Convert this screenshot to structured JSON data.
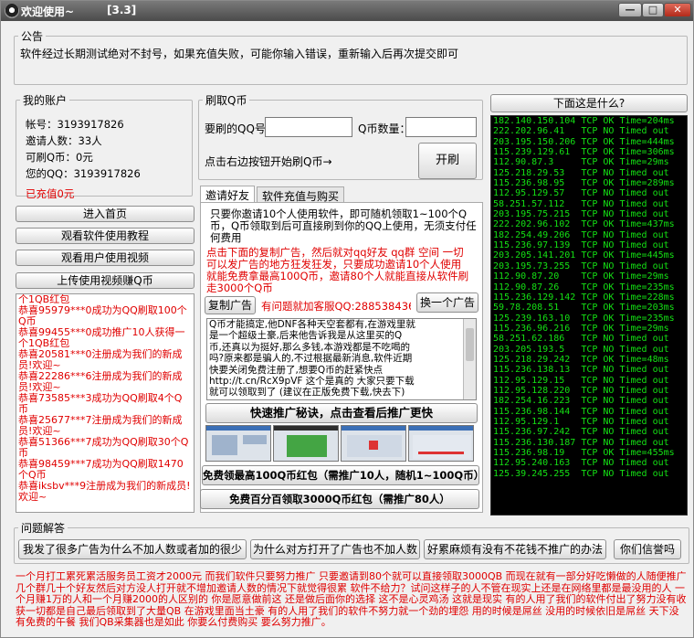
{
  "window": {
    "title": "欢迎使用~",
    "version": "[3.3]",
    "min_icon": "minimize-icon",
    "max_icon": "maximize-icon",
    "close_icon": "close-icon",
    "min_glyph": "—",
    "max_glyph": "□",
    "close_glyph": "✕"
  },
  "notice": {
    "legend": "公告",
    "text": "软件经过长期测试绝对不封号，如果充值失败，可能你输入错误，重新输入后再次提交即可"
  },
  "account": {
    "legend": "我的账户",
    "account_line": "帐号：3193917826",
    "invite_line": "邀请人数：33人",
    "can_claim_line": "可刷Q币：0元",
    "qq_line": "您的QQ：3193917826",
    "recharged_line": "已充值0元"
  },
  "left_buttons": {
    "enter_home": "进入首页",
    "watch_tutorial": "观看软件使用教程",
    "watch_user_video": "观看用户使用视频",
    "upload_video": "上传使用视频赚Q币"
  },
  "feed": [
    "个1QB红包",
    "恭喜95979***0成功为QQ刷取100个Q币",
    "恭喜99455***0成功推广10人获得一个1QB红包",
    "恭喜20581***0注册成为我们的新成员!欢迎~",
    "恭喜22286***6注册成为我们的新成员!欢迎~",
    "恭喜73585***3成功为QQ刷取4个Q币",
    "恭喜25677***7注册成为我们的新成员!欢迎~",
    "恭喜51366***7成功为QQ刷取30个Q币",
    "恭喜98459***7成功为QQ刷取1470个Q币",
    "恭喜iksbv***9注册成为我们的新成员!欢迎~"
  ],
  "refill": {
    "legend": "刷取Q币",
    "qq_label": "要刷的QQ号",
    "qq_value": "",
    "amount_label": "Q币数量：",
    "amount_value": "",
    "hint": "点击右边按钮开始刷Q币→",
    "start_button": "开刷"
  },
  "tabs": {
    "invite_tab": "邀请好友",
    "recharge_tab": "软件充值与购买"
  },
  "invite": {
    "desc_lines": [
      "只要你邀请10个人使用软件，即可随机领取1~100个Q",
      "币，Q币领取到后可直接刷到你的QQ上使用，无须支付任",
      "何费用"
    ],
    "red_lines": [
      "点击下面的复制广告，然后就对qq好友 qq群 空间 一切",
      "可以发广告的地方狂发狂发，只要成功邀请10个人使用",
      "就能免费拿最高100Q币，邀请80个人就能直接从软件刷",
      "走3000个Q币"
    ],
    "copy_ad_button": "复制广告",
    "support_text": "有问题就加客服QQ:2885384362",
    "switch_ad_button": "换一个广告",
    "ad_lines": [
      "Q币才能搞定,他DNF各种天空套都有,在游戏里就",
      "是一个超级土豪,后来他告诉我是从这里买的Q",
      "币,还真以为挺好,那么多钱,本游戏都是不吃喝的",
      "吗?原来都是骗人的,不过根据最新消息,软件近期",
      "快要关闭免费注册了,想要Q币的赶紧快点",
      "http://t.cn/RcX9pVF 这个是真的 大家只要下载",
      "就可以领取到了 (建议在正版免费下载,快去下)"
    ],
    "fast_promo_button": "快速推广秘诀，点击查看后推广更快",
    "free_100_button": "免费领最高100Q币红包（需推广10人，随机1~100Q币）",
    "free_3000_button": "免费百分百领取3000Q币红包（需推广80人）"
  },
  "ip_panel": {
    "button": "下面这是什么?",
    "rows": [
      {
        "ip": "182.140.150.104",
        "status": "TCP OK Time=204ms"
      },
      {
        "ip": "222.202.96.41",
        "status": "TCP NO Timed out"
      },
      {
        "ip": "203.195.150.206",
        "status": "TCP OK Time=444ms"
      },
      {
        "ip": "115.239.129.61",
        "status": "TCP OK Time=306ms"
      },
      {
        "ip": "112.90.87.3",
        "status": "TCP OK Time=29ms"
      },
      {
        "ip": "125.218.29.53",
        "status": "TCP NO Timed out"
      },
      {
        "ip": "115.236.98.95",
        "status": "TCP OK Time=289ms"
      },
      {
        "ip": "112.95.129.57",
        "status": "TCP NO Timed out"
      },
      {
        "ip": "58.251.57.112",
        "status": "TCP NO Timed out"
      },
      {
        "ip": "203.195.75.215",
        "status": "TCP NO Timed out"
      },
      {
        "ip": "222.202.96.102",
        "status": "TCP OK Time=437ms"
      },
      {
        "ip": "182.254.49.206",
        "status": "TCP NO Timed out"
      },
      {
        "ip": "115.236.97.139",
        "status": "TCP NO Timed out"
      },
      {
        "ip": "203.205.141.201",
        "status": "TCP OK Time=445ms"
      },
      {
        "ip": "203.195.73.255",
        "status": "TCP NO Timed out"
      },
      {
        "ip": "112.90.87.20",
        "status": "TCP OK Time=29ms"
      },
      {
        "ip": "112.90.87.26",
        "status": "TCP OK Time=235ms"
      },
      {
        "ip": "115.236.129.142",
        "status": "TCP OK Time=228ms"
      },
      {
        "ip": "59.78.208.51",
        "status": "TCP OK Time=203ms"
      },
      {
        "ip": "125.239.163.10",
        "status": "TCP OK Time=235ms"
      },
      {
        "ip": "115.236.96.216",
        "status": "TCP OK Time=29ms"
      },
      {
        "ip": "58.251.62.186",
        "status": "TCP NO Timed out"
      },
      {
        "ip": "203.205.193.5",
        "status": "TCP NO Timed out"
      },
      {
        "ip": "125.218.29.242",
        "status": "TCP OK Time=48ms"
      },
      {
        "ip": "115.236.138.13",
        "status": "TCP NO Timed out"
      },
      {
        "ip": "112.95.129.15",
        "status": "TCP NO Timed out"
      },
      {
        "ip": "112.95.128.220",
        "status": "TCP NO Timed out"
      },
      {
        "ip": "182.254.16.223",
        "status": "TCP NO Timed out"
      },
      {
        "ip": "115.236.98.144",
        "status": "TCP NO Timed out"
      },
      {
        "ip": "112.95.129.1",
        "status": "TCP NO Timed out"
      },
      {
        "ip": "115.236.97.242",
        "status": "TCP NO Timed out"
      },
      {
        "ip": "115.236.130.187",
        "status": "TCP NO Timed out"
      },
      {
        "ip": "115.236.98.19",
        "status": "TCP OK Time=455ms"
      },
      {
        "ip": "112.95.240.163",
        "status": "TCP NO Timed out"
      },
      {
        "ip": "125.39.245.255",
        "status": "TCP NO Timed out"
      }
    ]
  },
  "faq": {
    "legend": "问题解答",
    "q1": "我发了很多广告为什么不加人数或者加的很少",
    "q2": "为什么对方打开了广告也不加人数",
    "q3": "好累麻烦有没有不花钱不推广的办法",
    "q4": "你们信誉吗"
  },
  "bottom_text": "一个月打工累死累活服务员工资才2000元 而我们软件只要努力推广 只要邀请到80个就可以直接领取3000QB 而现在就有一部分好吃懒做的人随便推广几个群几十个好友然后对方没人打开就不增加邀请人数的情况下就觉得很累 软件不给力？试问这样子的人不管在现实上还是在网络里都是最没用的人 一个月赚1万的人和一个月赚2000的人区别的 你是愿意做前这 还是做后面你的选择 这不是心灵鸡汤 这就是现实 有的人用了我们的软件付出了努力没有收获一切都是自己最后领取到了大量QB 在游戏里面当土豪 有的人用了我们的软件不努力就一个劲的埋怨 用的时候是屌丝 没用的时候依旧是屌丝 天下没有免费的午餐 我们QB采集器也是如此 你要么付费购买 要么努力推广。",
  "colors": {
    "red_text": "#e00000",
    "ip_green": "#14e014",
    "titlebar": "#4b4b4b"
  }
}
